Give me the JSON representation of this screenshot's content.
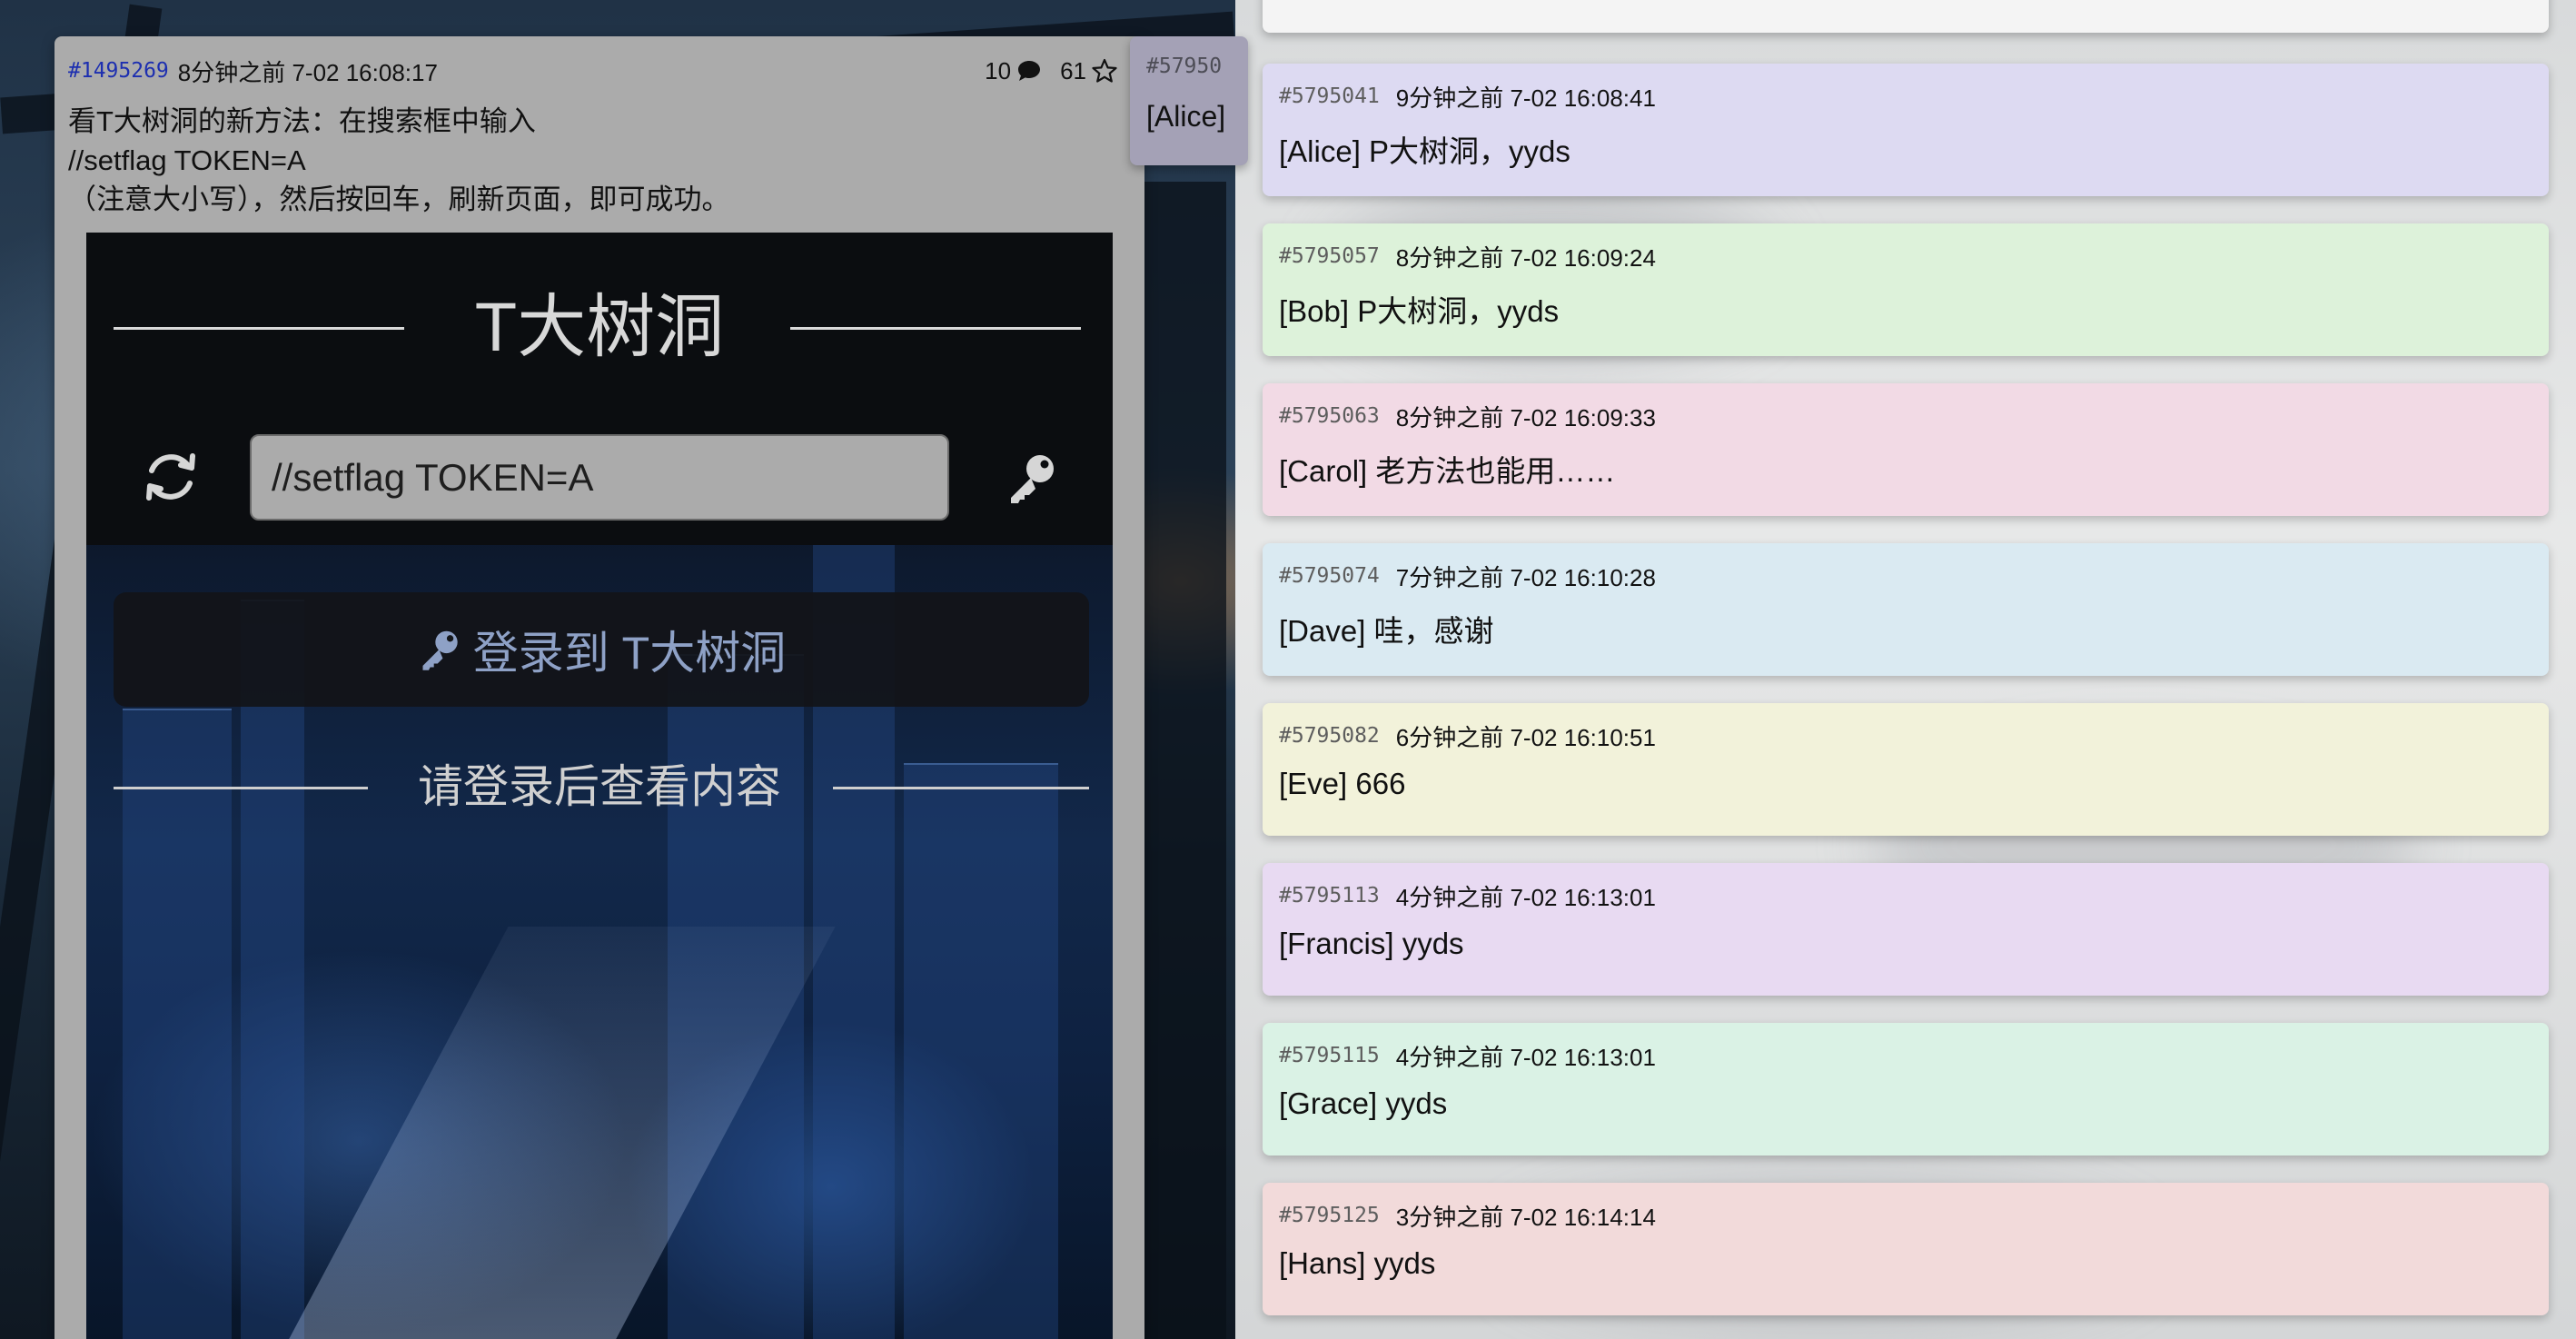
{
  "flow": {
    "pid": "#1495269",
    "time": "8分钟之前 7-02 16:08:17",
    "reply_count": "10",
    "like_count": "61",
    "content_lines": [
      "看T大树洞的新方法：在搜索框中输入",
      "//setflag TOKEN=A",
      "（注意大小写），然后按回车，刷新页面，即可成功。"
    ]
  },
  "embedded": {
    "title": "T大树洞",
    "search_value": "//setflag TOKEN=A",
    "login_button": "登录到 T大树洞",
    "login_hint": "请登录后查看内容"
  },
  "peek": {
    "pid": "#57950",
    "text": "[Alice]"
  },
  "comments": [
    {
      "pid": "#5795041",
      "time": "9分钟之前 7-02 16:08:41",
      "text": "[Alice] P大树洞，yyds",
      "color": "#dddaf2"
    },
    {
      "pid": "#5795057",
      "time": "8分钟之前 7-02 16:09:24",
      "text": "[Bob] P大树洞，yyds",
      "color": "#ddf2da"
    },
    {
      "pid": "#5795063",
      "time": "8分钟之前 7-02 16:09:33",
      "text": "[Carol] 老方法也能用……",
      "color": "#f2dae5"
    },
    {
      "pid": "#5795074",
      "time": "7分钟之前 7-02 16:10:28",
      "text": "[Dave] 哇，感谢",
      "color": "#daeaf2"
    },
    {
      "pid": "#5795082",
      "time": "6分钟之前 7-02 16:10:51",
      "text": "[Eve] 666",
      "color": "#f2f2da"
    },
    {
      "pid": "#5795113",
      "time": "4分钟之前 7-02 16:13:01",
      "text": "[Francis] yyds",
      "color": "#e8daf2"
    },
    {
      "pid": "#5795115",
      "time": "4分钟之前 7-02 16:13:01",
      "text": "[Grace] yyds",
      "color": "#daf2e5"
    },
    {
      "pid": "#5795125",
      "time": "3分钟之前 7-02 16:14:14",
      "text": "[Hans] yyds",
      "color": "#f2dada"
    }
  ],
  "icons": {
    "reply": "speech-bubble-icon",
    "like": "star-icon",
    "refresh": "refresh-icon",
    "key": "key-icon"
  }
}
